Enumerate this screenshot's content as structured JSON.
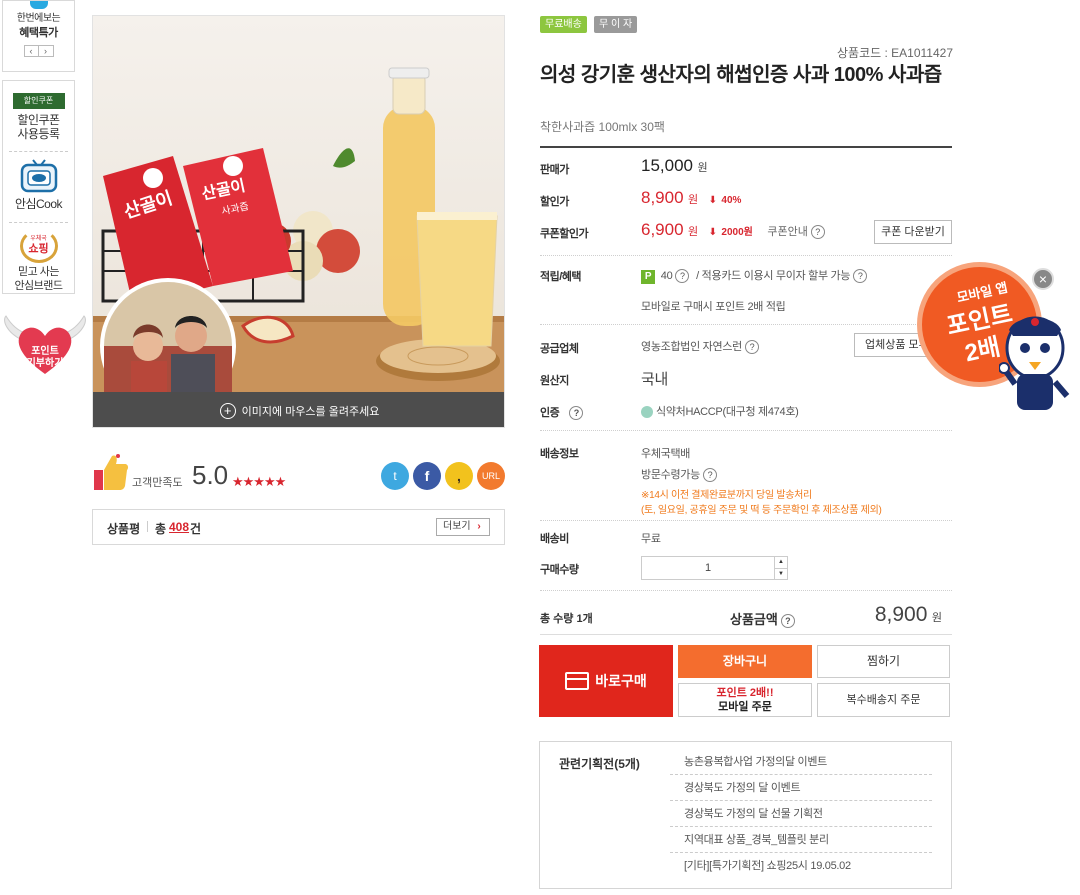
{
  "sidebar": {
    "promo_line1": "한번에보는",
    "promo_line2": "혜택특가",
    "coupon_badge": "할인쿠폰",
    "coupon_line1": "할인쿠폰",
    "coupon_line2": "사용등록",
    "cook_label": "안심Cook",
    "shop_badge_top": "우체국",
    "shop_badge_main": "쇼핑",
    "shop_line1": "믿고 사는",
    "shop_line2": "안심브랜드",
    "donate_line1": "포인트",
    "donate_line2": "기부하기"
  },
  "gallery": {
    "pouch_text": "산골이",
    "pouch_sub": "사과즙",
    "hover_hint": "이미지에 마우스를 올려주세요"
  },
  "rating": {
    "label": "고객만족도",
    "score": "5.0",
    "stars": 5
  },
  "share": {
    "url_label": "URL"
  },
  "reviews": {
    "label": "상품평",
    "total_prefix": "총",
    "count": "408",
    "unit": "건",
    "more_label": "더보기"
  },
  "badges": {
    "free_shipping": "무료배송",
    "interest_free": "무 이 자"
  },
  "product": {
    "code": "상품코드 : EA1011427",
    "title": "의성 강기훈 생산자의 해썹인증 사과 100% 사과즙",
    "subtitle": "착한사과즙 100mlx 30팩"
  },
  "price": {
    "sale_label": "판매가",
    "sale_value": "15,000",
    "won": "원",
    "discount_label": "할인가",
    "discount_value": "8,900",
    "discount_rate": "40%",
    "coupon_label": "쿠폰할인가",
    "coupon_value": "6,900",
    "coupon_off": "2000원",
    "coupon_info": "쿠폰안내",
    "coupon_button": "쿠폰 다운받기"
  },
  "points": {
    "label": "적립/혜택",
    "p_badge": "P",
    "value": "40",
    "card_info": "/ 적용카드 이용시 무이자 할부 가능",
    "mobile_info": "모바일로 구매시 포인트 2배 적립"
  },
  "supplier": {
    "label": "공급업체",
    "value": "영농조합법인 자연스런",
    "other_button": "업체상품 모두"
  },
  "origin": {
    "label": "원산지",
    "value": "국내"
  },
  "certification": {
    "label": "인증",
    "value": "식약처HACCP(대구청 제474호)"
  },
  "shipping": {
    "label": "배송정보",
    "method": "우체국택배",
    "pickup": "방문수령가능",
    "notice1": "※14시 이전 결제완료분까지 당일 발송처리",
    "notice2": "(토, 일요일, 공휴일 주문 및 떡 등 주문확인 후 제조상품 제외)"
  },
  "fee": {
    "label": "배송비",
    "value": "무료"
  },
  "quantity": {
    "label": "구매수량",
    "value": "1"
  },
  "total": {
    "qty_label": "총 수량 1개",
    "amount_label": "상품금액",
    "amount_value": "8,900",
    "won": "원"
  },
  "actions": {
    "buy_now": "바로구매",
    "cart": "장바구니",
    "wish": "찜하기",
    "mobile_line1": "포인트 2배!!",
    "mobile_line2": "모바일 주문",
    "multi_ship": "복수배송지 주문"
  },
  "events": {
    "title": "관련기획전(5개)",
    "items": [
      "농촌융복합사업 가정의달 이벤트",
      "경상북도 가정의 달 이벤트",
      "경상북도 가정의 달 선물 기획전",
      "지역대표 상품_경북_템플릿 분리",
      "[기타][특가기획전] 쇼핑25시 19.05.02"
    ]
  },
  "floating_promo": {
    "line1": "모바일 앱",
    "line2": "포인트",
    "line3": "2배"
  },
  "colors": {
    "accent_red": "#d8262f",
    "buy_now_bg": "#e0261c",
    "cart_bg": "#f46d2e",
    "free_ship_green": "#8dc63f",
    "interest_gray": "#9a9a9a",
    "promo_orange": "#f05a23"
  }
}
